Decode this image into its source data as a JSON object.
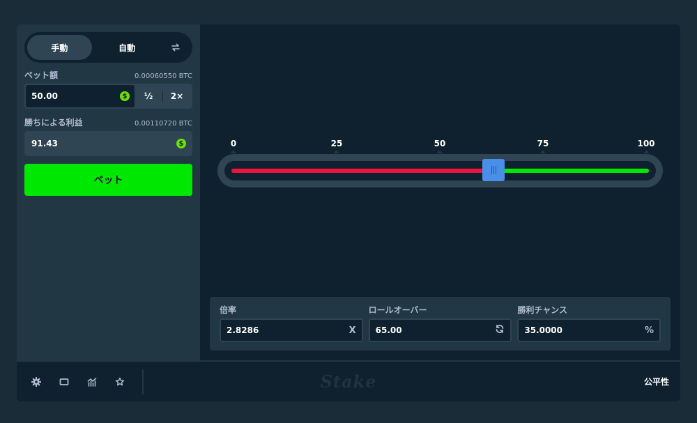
{
  "sidebar": {
    "tabs": [
      {
        "label": "手動",
        "active": true
      },
      {
        "label": "自動",
        "active": false
      }
    ],
    "swap_icon": "swap-arrows-icon",
    "bet_amount": {
      "label": "ベット額",
      "btc_value": "0.00060550 BTC",
      "value": "50.00",
      "currency_icon": "dollar-coin-icon",
      "half_label": "½",
      "double_label": "2×"
    },
    "profit": {
      "label": "勝ちによる利益",
      "btc_value": "0.00110720 BTC",
      "value": "91.43",
      "currency_icon": "dollar-coin-icon"
    },
    "bet_button_label": "ベット"
  },
  "game": {
    "slider": {
      "ticks": [
        "0",
        "25",
        "50",
        "75",
        "100"
      ],
      "min": 0,
      "max": 100,
      "value": 65,
      "lose_color": "#ed143d",
      "win_color": "#00e701",
      "handle_color": "#4a8fe7"
    },
    "stats": {
      "multiplier": {
        "label": "倍率",
        "value": "2.8286",
        "suffix": "X"
      },
      "roll_over": {
        "label": "ロールオーバー",
        "value": "65.00",
        "suffix_icon": "refresh-icon"
      },
      "win_chance": {
        "label": "勝利チャンス",
        "value": "35.0000",
        "suffix": "%"
      }
    }
  },
  "footer": {
    "icons": [
      "gear-icon",
      "square-icon",
      "stats-chart-icon",
      "star-icon"
    ],
    "logo": "Stake",
    "fairness_label": "公平性"
  }
}
